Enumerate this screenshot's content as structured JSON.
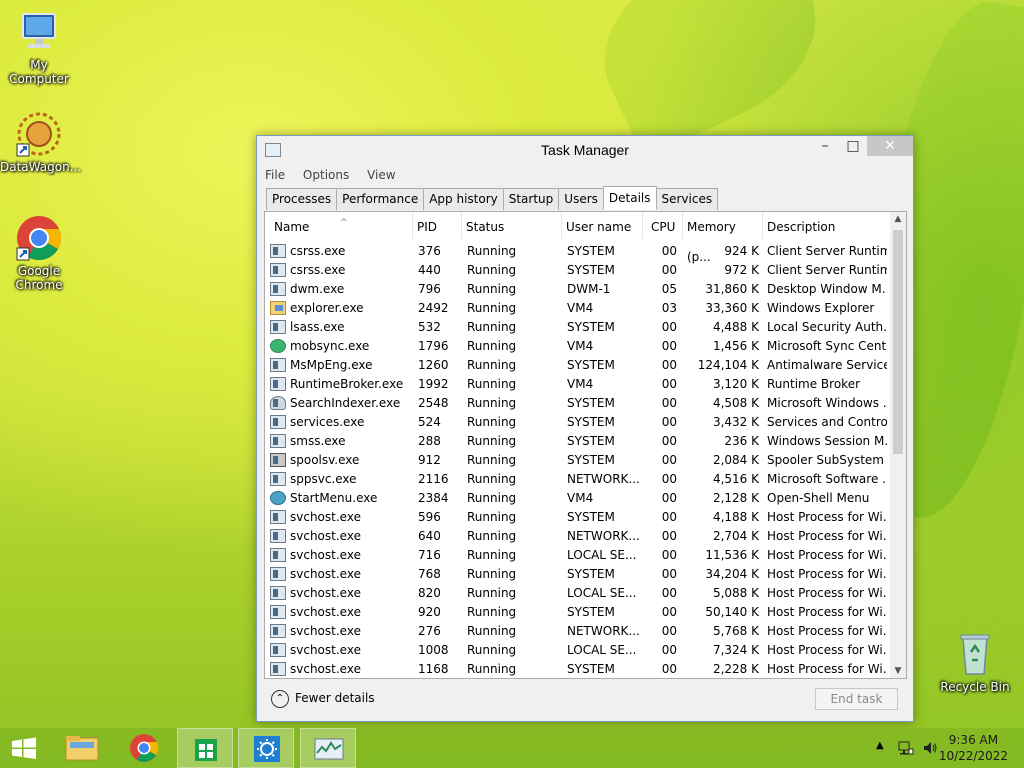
{
  "desktop": {
    "icons": [
      {
        "label": "My Computer",
        "icon": "computer-icon"
      },
      {
        "label": "DataWagon...",
        "icon": "datawagon-icon"
      },
      {
        "label": "Google Chrome",
        "icon": "chrome-icon"
      },
      {
        "label": "Recycle Bin",
        "icon": "recycle-bin-icon"
      }
    ]
  },
  "window": {
    "title": "Task Manager",
    "menu": [
      "File",
      "Options",
      "View"
    ],
    "tabs": [
      "Processes",
      "Performance",
      "App history",
      "Startup",
      "Users",
      "Details",
      "Services"
    ],
    "active_tab": "Details",
    "columns": [
      "Name",
      "PID",
      "Status",
      "User name",
      "CPU",
      "Memory (p...",
      "Description"
    ],
    "rows": [
      {
        "name": "csrss.exe",
        "pid": "376",
        "status": "Running",
        "user": "SYSTEM",
        "cpu": "00",
        "mem": "924 K",
        "desc": "Client Server Runtim...",
        "icon": "generic"
      },
      {
        "name": "csrss.exe",
        "pid": "440",
        "status": "Running",
        "user": "SYSTEM",
        "cpu": "00",
        "mem": "972 K",
        "desc": "Client Server Runtim...",
        "icon": "generic"
      },
      {
        "name": "dwm.exe",
        "pid": "796",
        "status": "Running",
        "user": "DWM-1",
        "cpu": "05",
        "mem": "31,860 K",
        "desc": "Desktop Window M...",
        "icon": "generic"
      },
      {
        "name": "explorer.exe",
        "pid": "2492",
        "status": "Running",
        "user": "VM4",
        "cpu": "03",
        "mem": "33,360 K",
        "desc": "Windows Explorer",
        "icon": "folder"
      },
      {
        "name": "lsass.exe",
        "pid": "532",
        "status": "Running",
        "user": "SYSTEM",
        "cpu": "00",
        "mem": "4,488 K",
        "desc": "Local Security Auth...",
        "icon": "generic"
      },
      {
        "name": "mobsync.exe",
        "pid": "1796",
        "status": "Running",
        "user": "VM4",
        "cpu": "00",
        "mem": "1,456 K",
        "desc": "Microsoft Sync Center",
        "icon": "round"
      },
      {
        "name": "MsMpEng.exe",
        "pid": "1260",
        "status": "Running",
        "user": "SYSTEM",
        "cpu": "00",
        "mem": "124,104 K",
        "desc": "Antimalware Service...",
        "icon": "generic"
      },
      {
        "name": "RuntimeBroker.exe",
        "pid": "1992",
        "status": "Running",
        "user": "VM4",
        "cpu": "00",
        "mem": "3,120 K",
        "desc": "Runtime Broker",
        "icon": "generic"
      },
      {
        "name": "SearchIndexer.exe",
        "pid": "2548",
        "status": "Running",
        "user": "SYSTEM",
        "cpu": "00",
        "mem": "4,508 K",
        "desc": "Microsoft Windows ...",
        "icon": "search"
      },
      {
        "name": "services.exe",
        "pid": "524",
        "status": "Running",
        "user": "SYSTEM",
        "cpu": "00",
        "mem": "3,432 K",
        "desc": "Services and Control...",
        "icon": "generic"
      },
      {
        "name": "smss.exe",
        "pid": "288",
        "status": "Running",
        "user": "SYSTEM",
        "cpu": "00",
        "mem": "236 K",
        "desc": "Windows Session M...",
        "icon": "generic"
      },
      {
        "name": "spoolsv.exe",
        "pid": "912",
        "status": "Running",
        "user": "SYSTEM",
        "cpu": "00",
        "mem": "2,084 K",
        "desc": "Spooler SubSystem ...",
        "icon": "print"
      },
      {
        "name": "sppsvc.exe",
        "pid": "2116",
        "status": "Running",
        "user": "NETWORK...",
        "cpu": "00",
        "mem": "4,516 K",
        "desc": "Microsoft Software ...",
        "icon": "generic"
      },
      {
        "name": "StartMenu.exe",
        "pid": "2384",
        "status": "Running",
        "user": "VM4",
        "cpu": "00",
        "mem": "2,128 K",
        "desc": "Open-Shell Menu",
        "icon": "globe"
      },
      {
        "name": "svchost.exe",
        "pid": "596",
        "status": "Running",
        "user": "SYSTEM",
        "cpu": "00",
        "mem": "4,188 K",
        "desc": "Host Process for Wi...",
        "icon": "generic"
      },
      {
        "name": "svchost.exe",
        "pid": "640",
        "status": "Running",
        "user": "NETWORK...",
        "cpu": "00",
        "mem": "2,704 K",
        "desc": "Host Process for Wi...",
        "icon": "generic"
      },
      {
        "name": "svchost.exe",
        "pid": "716",
        "status": "Running",
        "user": "LOCAL SE...",
        "cpu": "00",
        "mem": "11,536 K",
        "desc": "Host Process for Wi...",
        "icon": "generic"
      },
      {
        "name": "svchost.exe",
        "pid": "768",
        "status": "Running",
        "user": "SYSTEM",
        "cpu": "00",
        "mem": "34,204 K",
        "desc": "Host Process for Wi...",
        "icon": "generic"
      },
      {
        "name": "svchost.exe",
        "pid": "820",
        "status": "Running",
        "user": "LOCAL SE...",
        "cpu": "00",
        "mem": "5,088 K",
        "desc": "Host Process for Wi...",
        "icon": "generic"
      },
      {
        "name": "svchost.exe",
        "pid": "920",
        "status": "Running",
        "user": "SYSTEM",
        "cpu": "00",
        "mem": "50,140 K",
        "desc": "Host Process for Wi...",
        "icon": "generic"
      },
      {
        "name": "svchost.exe",
        "pid": "276",
        "status": "Running",
        "user": "NETWORK...",
        "cpu": "00",
        "mem": "5,768 K",
        "desc": "Host Process for Wi...",
        "icon": "generic"
      },
      {
        "name": "svchost.exe",
        "pid": "1008",
        "status": "Running",
        "user": "LOCAL SE...",
        "cpu": "00",
        "mem": "7,324 K",
        "desc": "Host Process for Wi...",
        "icon": "generic"
      },
      {
        "name": "svchost.exe",
        "pid": "1168",
        "status": "Running",
        "user": "SYSTEM",
        "cpu": "00",
        "mem": "2,228 K",
        "desc": "Host Process for Wi...",
        "icon": "generic"
      }
    ],
    "footer": {
      "fewer_details": "Fewer details",
      "end_task": "End task"
    }
  },
  "taskbar": {
    "apps": [
      "start-icon",
      "file-explorer-icon",
      "chrome-icon",
      "store-icon",
      "settings-icon",
      "task-manager-icon"
    ],
    "time": "9:36 AM",
    "date": "10/22/2022"
  }
}
